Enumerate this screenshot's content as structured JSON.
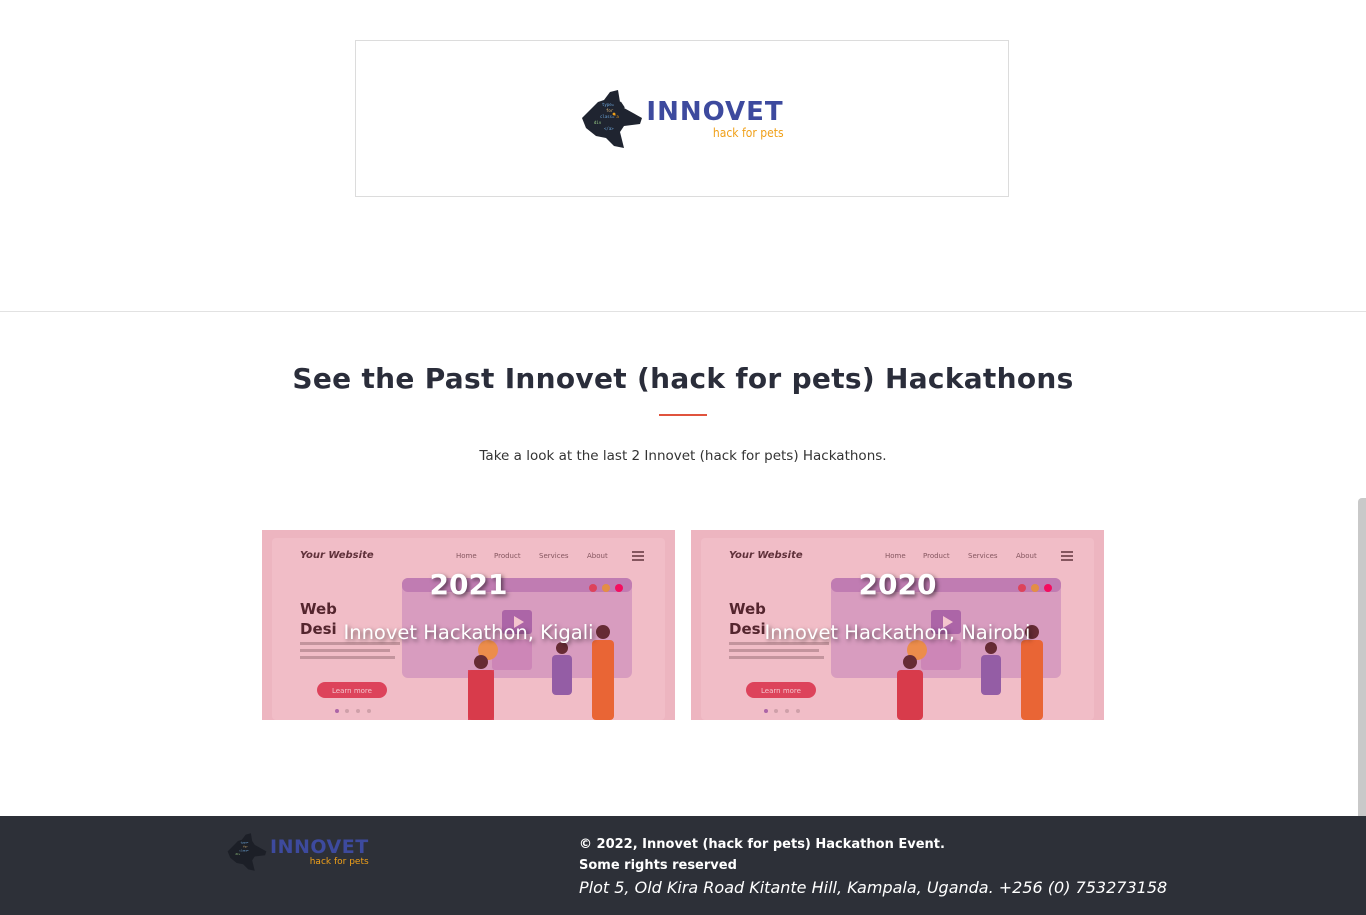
{
  "sponsor_logo": {
    "brand": "INNOVET",
    "tagline": "hack for pets"
  },
  "past_section": {
    "title": "See the Past Innovet (hack for pets) Hackathons",
    "subtitle": "Take a look at the last 2 Innovet (hack for pets) Hackathons.",
    "cards": [
      {
        "year": "2021",
        "event": "Innovet Hackathon, Kigali",
        "bg_mock": {
          "site_title": "Your Website",
          "nav": [
            "Home",
            "Product",
            "Services",
            "About"
          ],
          "hero_line1": "Web",
          "hero_line2": "Desi",
          "button": "Learn more"
        }
      },
      {
        "year": "2020",
        "event": "Innovet Hackathon, Nairobi",
        "bg_mock": {
          "site_title": "Your Website",
          "nav": [
            "Home",
            "Product",
            "Services",
            "About"
          ],
          "hero_line1": "Web",
          "hero_line2": "Desi",
          "button": "Learn more"
        }
      }
    ]
  },
  "footer": {
    "brand": "INNOVET",
    "tagline": "hack for pets",
    "copyright": "© 2022, Innovet (hack for pets) Hackathon Event.",
    "rights": "Some rights reserved",
    "address": "Plot 5, Old Kira Road Kitante Hill, Kampala, Uganda. +256 (0) 753273158"
  },
  "colors": {
    "brand_blue": "#3d4a9e",
    "brand_orange": "#f0a019",
    "accent_red": "#e0533d",
    "footer_bg": "#2d3038"
  }
}
